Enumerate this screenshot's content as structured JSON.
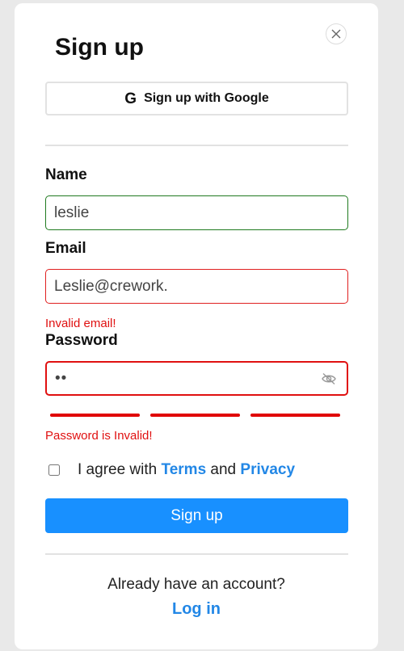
{
  "modal": {
    "title": "Sign up",
    "close_icon": "close-icon"
  },
  "google": {
    "label": "Sign up with Google",
    "icon": "G"
  },
  "name": {
    "label": "Name",
    "value": "leslie"
  },
  "email": {
    "label": "Email",
    "value": "Leslie@crework.",
    "error": "Invalid email!"
  },
  "password": {
    "label": "Password",
    "value": "••",
    "error": "Password is Invalid!",
    "toggle_icon": "eye-off-icon"
  },
  "agree": {
    "prefix": "I agree with",
    "terms": "Terms",
    "conjunction": "and",
    "privacy": "Privacy"
  },
  "submit": {
    "label": "Sign up"
  },
  "footer": {
    "prompt": "Already have an account?",
    "login": "Log in"
  },
  "colors": {
    "primary": "#1890ff",
    "link": "#2287e6",
    "error": "#e01010",
    "success_border": "#1f7a1f"
  }
}
